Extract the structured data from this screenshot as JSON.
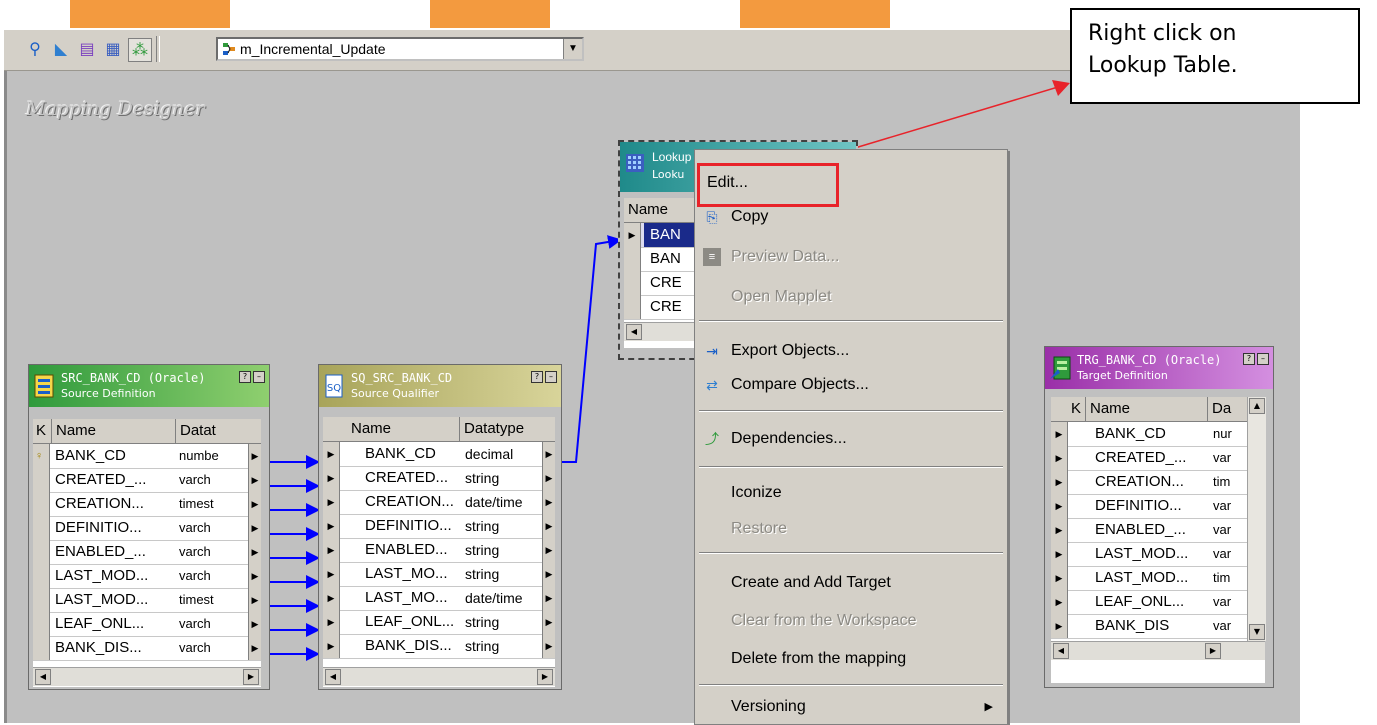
{
  "toolbar": {
    "mapping_name": "m_Incremental_Update"
  },
  "workspace": {
    "title": "Mapping Designer"
  },
  "source": {
    "title": "SRC_BANK_CD (Oracle)",
    "subtitle": "Source Definition",
    "col_key": "K",
    "col_name": "Name",
    "col_datatype": "Datat",
    "rows": [
      {
        "name": "BANK_CD",
        "type": "numbe"
      },
      {
        "name": "CREATED_...",
        "type": "varch"
      },
      {
        "name": "CREATION...",
        "type": "timest"
      },
      {
        "name": "DEFINITIO...",
        "type": "varch"
      },
      {
        "name": "ENABLED_...",
        "type": "varch"
      },
      {
        "name": "LAST_MOD...",
        "type": "varch"
      },
      {
        "name": "LAST_MOD...",
        "type": "timest"
      },
      {
        "name": "LEAF_ONL...",
        "type": "varch"
      },
      {
        "name": "BANK_DIS...",
        "type": "varch"
      }
    ]
  },
  "qualifier": {
    "title": "SQ_SRC_BANK_CD",
    "subtitle": "Source Qualifier",
    "col_name": "Name",
    "col_datatype": "Datatype",
    "rows": [
      {
        "name": "BANK_CD",
        "type": "decimal"
      },
      {
        "name": "CREATED...",
        "type": "string"
      },
      {
        "name": "CREATION...",
        "type": "date/time"
      },
      {
        "name": "DEFINITIO...",
        "type": "string"
      },
      {
        "name": "ENABLED...",
        "type": "string"
      },
      {
        "name": "LAST_MO...",
        "type": "string"
      },
      {
        "name": "LAST_MO...",
        "type": "date/time"
      },
      {
        "name": "LEAF_ONL...",
        "type": "string"
      },
      {
        "name": "BANK_DIS...",
        "type": "string"
      }
    ]
  },
  "lookup": {
    "title": "Lookup",
    "subtitle": "Looku",
    "col_name": "Name",
    "rows": [
      {
        "name": "BAN"
      },
      {
        "name": "BAN"
      },
      {
        "name": "CRE"
      },
      {
        "name": "CRE"
      }
    ]
  },
  "target": {
    "title": "TRG_BANK_CD (Oracle)",
    "subtitle": "Target Definition",
    "col_key": "K",
    "col_name": "Name",
    "col_datatype": "Da",
    "rows": [
      {
        "name": "BANK_CD",
        "type": "nur"
      },
      {
        "name": "CREATED_...",
        "type": "var"
      },
      {
        "name": "CREATION...",
        "type": "tim"
      },
      {
        "name": "DEFINITIO...",
        "type": "var"
      },
      {
        "name": "ENABLED_...",
        "type": "var"
      },
      {
        "name": "LAST_MOD...",
        "type": "var"
      },
      {
        "name": "LAST_MOD...",
        "type": "tim"
      },
      {
        "name": "LEAF_ONL...",
        "type": "var"
      },
      {
        "name": "BANK_DIS",
        "type": "var"
      }
    ]
  },
  "context_menu": {
    "items": [
      {
        "label": "Edit...",
        "enabled": true,
        "icon": ""
      },
      {
        "label": "Copy",
        "enabled": true,
        "icon": "copy-icon"
      },
      {
        "label": "Preview Data...",
        "enabled": false,
        "icon": "preview-icon"
      },
      {
        "label": "Open Mapplet",
        "enabled": false,
        "icon": ""
      },
      {
        "label": "Export Objects...",
        "enabled": true,
        "icon": "export-icon"
      },
      {
        "label": "Compare Objects...",
        "enabled": true,
        "icon": "compare-icon"
      },
      {
        "label": "Dependencies...",
        "enabled": true,
        "icon": "dependencies-icon"
      },
      {
        "label": "Iconize",
        "enabled": true,
        "icon": ""
      },
      {
        "label": "Restore",
        "enabled": false,
        "icon": ""
      },
      {
        "label": "Create and Add Target",
        "enabled": true,
        "icon": ""
      },
      {
        "label": "Clear from the Workspace",
        "enabled": false,
        "icon": ""
      },
      {
        "label": "Delete from the mapping",
        "enabled": true,
        "icon": ""
      },
      {
        "label": "Versioning",
        "enabled": true,
        "icon": "submenu-arrow"
      }
    ]
  },
  "callout": {
    "text_line1": "Right click on",
    "text_line2": "Lookup Table."
  },
  "colors": {
    "source_header": "#2f9a3c",
    "qualifier_header": "#a8a45a",
    "lookup_header": "#1f8a8a",
    "target_header": "#9a2fa8",
    "link_line": "#0000ff",
    "annotation": "#e8232a"
  }
}
